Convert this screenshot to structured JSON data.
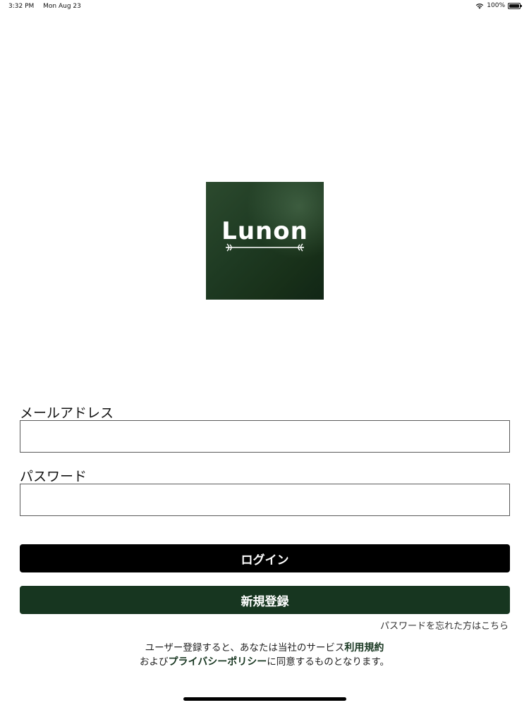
{
  "status_bar": {
    "time": "3:32 PM",
    "date": "Mon Aug 23",
    "battery": "100%",
    "icons": [
      "wifi-icon",
      "battery-icon"
    ]
  },
  "logo": {
    "text": "Lunon"
  },
  "form": {
    "email_label": "メールアドレス",
    "email_value": "",
    "password_label": "パスワード",
    "password_value": ""
  },
  "buttons": {
    "login": "ログイン",
    "register": "新規登録"
  },
  "forgot_password": "パスワードを忘れた方はこちら",
  "terms": {
    "line1_prefix": "ユーザー登録すると、あなたは当社のサービス",
    "terms_link": "利用規約",
    "line2_prefix": "および",
    "privacy_link": "プライバシーポリシー",
    "line2_suffix": "に同意するものとなります。"
  },
  "colors": {
    "brand_green": "#173620",
    "login_button": "#000000",
    "background": "#ffffff"
  }
}
